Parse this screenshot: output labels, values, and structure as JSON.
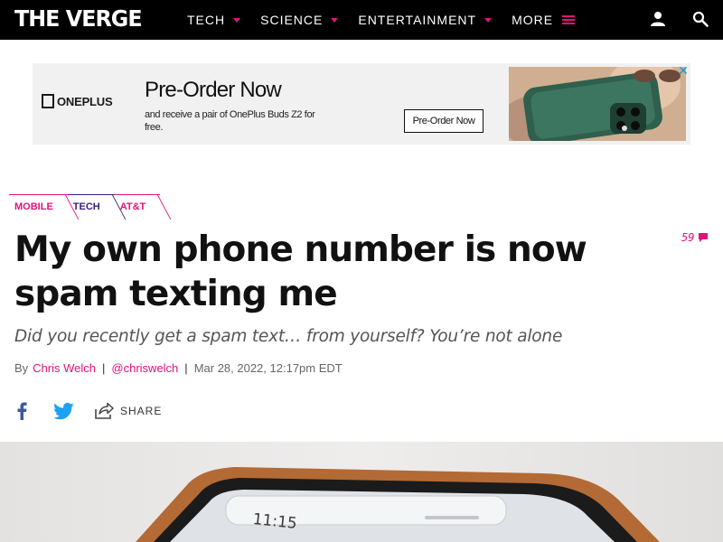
{
  "header": {
    "logo": "THE VERGE",
    "nav": [
      {
        "label": "TECH"
      },
      {
        "label": "SCIENCE"
      },
      {
        "label": "ENTERTAINMENT"
      },
      {
        "label": "MORE"
      }
    ]
  },
  "ad": {
    "brand": "ONEPLUS",
    "headline": "Pre-Order Now",
    "subtext": "and receive a pair of OnePlus Buds Z2 for free.",
    "cta": "Pre-Order Now",
    "close_icon": "close-icon"
  },
  "article": {
    "tags": [
      "MOBILE",
      "TECH",
      "AT&T"
    ],
    "comment_count": "59",
    "title": "My own phone number is now spam texting me",
    "dek": "Did you recently get a spam text… from yourself? You’re not alone",
    "byline": {
      "prefix": "By",
      "author": "Chris Welch",
      "handle": "@chriswelch",
      "date": "Mar 28, 2022, 12:17pm EDT"
    },
    "share_label": "SHARE",
    "hero_phone_time": "11:15"
  },
  "colors": {
    "accent": "#e2127a",
    "header_bg": "#000000",
    "tech_tag": "#3a1f78"
  }
}
